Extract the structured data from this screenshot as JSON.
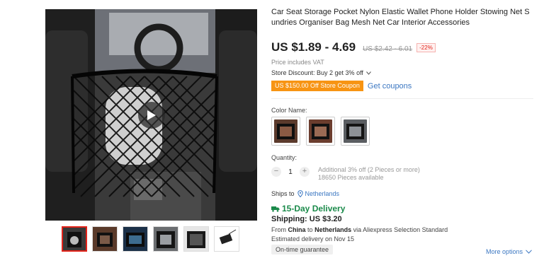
{
  "gallery": {
    "play_icon": "play-icon",
    "thumbnail_count": 6,
    "selected_thumbnail": 1
  },
  "product": {
    "title": "Car Seat Storage Pocket Nylon Elastic Wallet Phone Holder Stowing Net Sundries Organiser Bag Mesh Net Car Interior Accessories",
    "price": "US $1.89 - 4.69",
    "original_price": "US $2.42 - 6.01",
    "discount": "-22%",
    "vat_note": "Price includes VAT",
    "store_discount": "Store Discount: Buy 2 get 3% off",
    "coupon_badge": "US $150.00 Off Store Coupon",
    "get_coupons": "Get coupons"
  },
  "color": {
    "label": "Color Name:",
    "selected_index": 0
  },
  "quantity": {
    "label": "Quantity:",
    "value": "1",
    "minus": "−",
    "plus": "+",
    "note_line1": "Additional 3% off (2 Pieces or more)",
    "note_line2": "18650 Pieces available"
  },
  "shipping": {
    "ships_to_label": "Ships to",
    "ships_to_location": "Netherlands",
    "delivery": "15-Day Delivery",
    "cost": "Shipping: US $3.20",
    "from_prefix": "From",
    "from_country": "China",
    "to_word": "to",
    "to_country": "Netherlands",
    "via": "via Aliexpress Selection Standard",
    "estimated": "Estimated delivery on Nov 15",
    "guarantee": "On-time guarantee",
    "more_options": "More options"
  },
  "colors": {
    "accent_orange": "#f79413",
    "link_blue": "#3b77c2",
    "delivery_green": "#1a8a4a",
    "discount_red": "#e2231a"
  }
}
